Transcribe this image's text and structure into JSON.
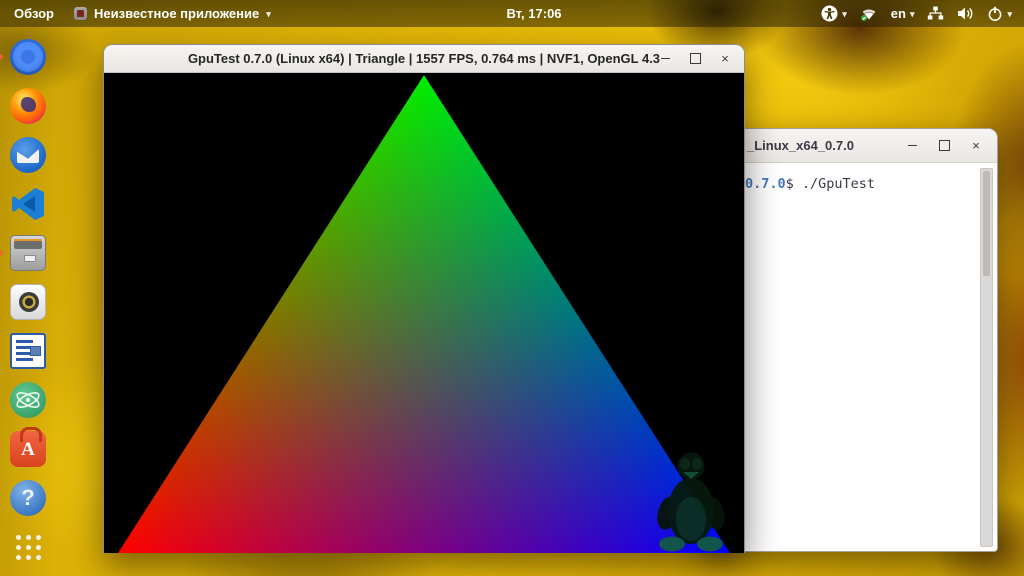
{
  "topbar": {
    "activities": "Обзор",
    "app_menu_label": "Неизвестное приложение",
    "caret": "▾",
    "clock": "Вт, 17:06",
    "language": "en",
    "status_icons": [
      "accessibility-icon",
      "wifi-icon",
      "keyboard-layout",
      "network-tree-icon",
      "volume-icon",
      "power-icon"
    ]
  },
  "dock": {
    "items": [
      {
        "name": "chromium",
        "running": true
      },
      {
        "name": "firefox",
        "running": false
      },
      {
        "name": "thunderbird",
        "running": false
      },
      {
        "name": "vscode",
        "running": false
      },
      {
        "name": "files",
        "running": true
      },
      {
        "name": "rhythmbox-speaker",
        "running": false
      },
      {
        "name": "libreoffice-writer",
        "running": false
      },
      {
        "name": "atom",
        "running": false
      },
      {
        "name": "ubuntu-software",
        "running": false
      },
      {
        "name": "help",
        "running": false
      },
      {
        "name": "app-grid",
        "running": false
      }
    ]
  },
  "gputest": {
    "title": "GpuTest 0.7.0 (Linux x64) | Triangle | 1557 FPS, 0.764 ms | NVF1, OpenGL 4.3",
    "controls": {
      "minimize": "–",
      "maximize": "□",
      "close": "×"
    },
    "triangle": {
      "top_color": "#00ee00",
      "left_color": "#ff0000",
      "right_color": "#0000ff",
      "background": "#000000",
      "watermark": "tux-linux-logo"
    }
  },
  "terminal": {
    "title_visible": "_Linux_x64_0.7.0",
    "controls": {
      "minimize": "–",
      "maximize": "□",
      "close": "×"
    },
    "prompt_path": "0.7.0",
    "prompt_rest": "$ ./GpuTest",
    "colors": {
      "prompt_blue": "#4179b8",
      "text": "#3d3846"
    }
  }
}
